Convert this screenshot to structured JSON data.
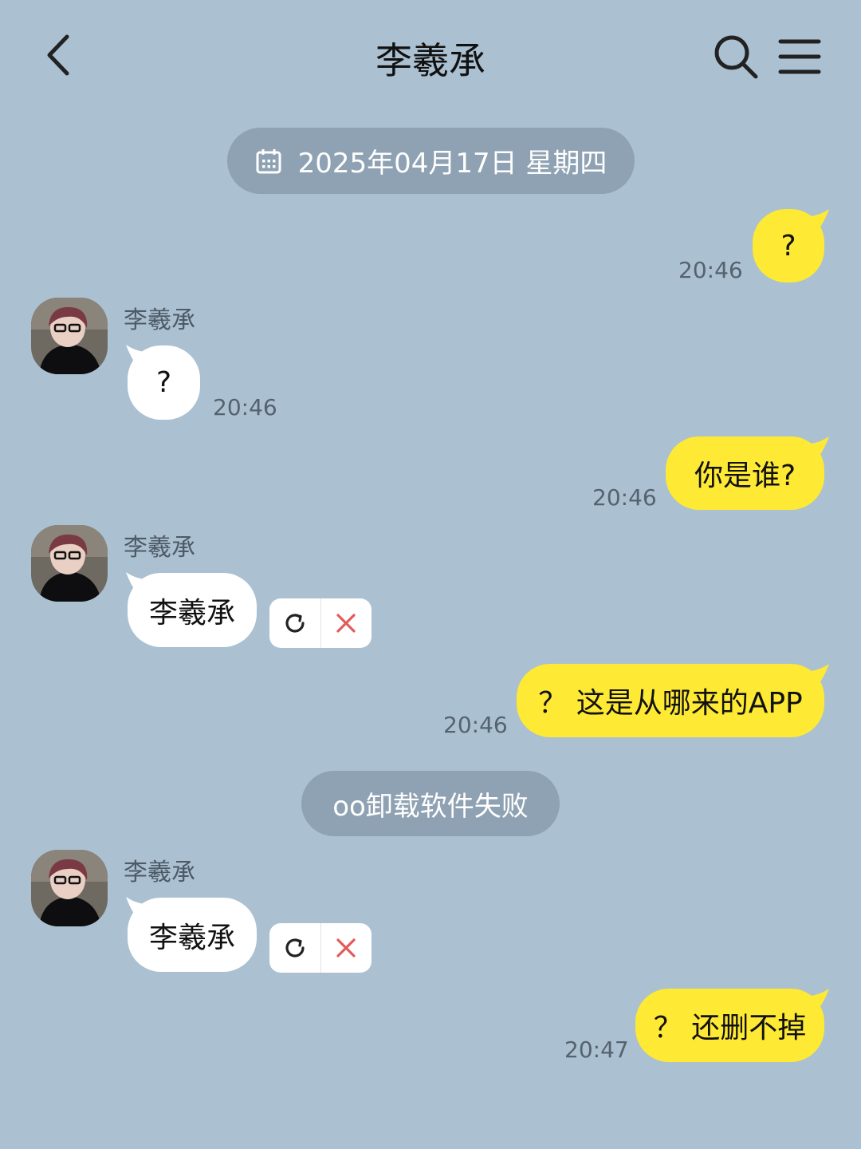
{
  "header": {
    "title": "李羲承",
    "icons": {
      "back": "chevron-left-icon",
      "search": "search-icon",
      "menu": "menu-icon"
    }
  },
  "date_divider": {
    "text": "2025年04月17日 星期四",
    "icon": "calendar-icon"
  },
  "messages": [
    {
      "direction": "outgoing",
      "text": "?",
      "time": "20:46"
    },
    {
      "direction": "incoming",
      "sender": "李羲承",
      "text": "?",
      "time": "20:46"
    },
    {
      "direction": "outgoing",
      "text": "你是谁?",
      "time": "20:46"
    },
    {
      "direction": "incoming",
      "sender": "李羲承",
      "text": "李羲承",
      "failed": true
    },
    {
      "direction": "outgoing",
      "text": "？ 这是从哪来的APP",
      "time": "20:46"
    },
    {
      "direction": "incoming",
      "sender": "李羲承",
      "text": "李羲承",
      "failed": true
    },
    {
      "direction": "outgoing",
      "text": "？ 还删不掉",
      "time": "20:47"
    }
  ],
  "system_notice": {
    "text": "oo卸载软件失败"
  },
  "colors": {
    "background": "#abc1d1",
    "outgoing_bubble": "#fee934",
    "incoming_bubble": "#ffffff",
    "pill": "#8fa2b3",
    "delete_x": "#e25b5b"
  }
}
